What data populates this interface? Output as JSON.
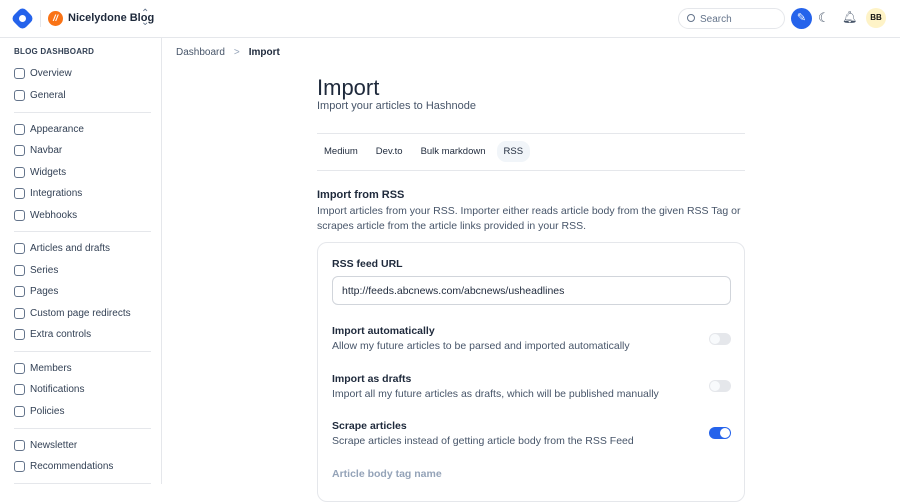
{
  "header": {
    "blog_initial": "//",
    "blog_name": "Nicelydone Blog",
    "search_placeholder": "Search",
    "avatar": "BB"
  },
  "sidebar": {
    "title": "BLOG DASHBOARD",
    "items": [
      {
        "label": "Overview",
        "icon": "overview-icon"
      },
      {
        "label": "General",
        "icon": "gear-icon"
      },
      {
        "label": "Appearance",
        "icon": "brush-icon"
      },
      {
        "label": "Navbar",
        "icon": "navbar-icon"
      },
      {
        "label": "Widgets",
        "icon": "puzzle-icon"
      },
      {
        "label": "Integrations",
        "icon": "plug-icon"
      },
      {
        "label": "Webhooks",
        "icon": "webhook-icon"
      },
      {
        "label": "Articles and drafts",
        "icon": "file-icon"
      },
      {
        "label": "Series",
        "icon": "series-icon"
      },
      {
        "label": "Pages",
        "icon": "page-icon"
      },
      {
        "label": "Custom page redirects",
        "icon": "redirect-icon"
      },
      {
        "label": "Extra controls",
        "icon": "controls-icon"
      },
      {
        "label": "Members",
        "icon": "members-icon"
      },
      {
        "label": "Notifications",
        "icon": "bell-icon"
      },
      {
        "label": "Policies",
        "icon": "policy-icon"
      },
      {
        "label": "Newsletter",
        "icon": "mail-icon"
      },
      {
        "label": "Recommendations",
        "icon": "recommend-icon"
      }
    ]
  },
  "breadcrumb": {
    "parent": "Dashboard",
    "sep": ">",
    "current": "Import"
  },
  "main": {
    "title": "Import",
    "subtitle": "Import your articles to Hashnode",
    "tabs": [
      {
        "label": "Medium"
      },
      {
        "label": "Dev.to"
      },
      {
        "label": "Bulk markdown"
      },
      {
        "label": "RSS"
      }
    ],
    "section_title": "Import from RSS",
    "section_desc": "Import articles from your RSS. Importer either reads article body from the given RSS Tag or scrapes article from the article links provided in your RSS.",
    "rss_label": "RSS feed URL",
    "rss_value": "http://feeds.abcnews.com/abcnews/usheadlines",
    "options": [
      {
        "title": "Import automatically",
        "desc": "Allow my future articles to be parsed and imported automatically",
        "enabled": false
      },
      {
        "title": "Import as drafts",
        "desc": "Import all my future articles as drafts, which will be published manually",
        "enabled": false
      },
      {
        "title": "Scrape articles",
        "desc": "Scrape articles instead of getting article body from the RSS Feed",
        "enabled": true
      }
    ],
    "body_tag_label": "Article body tag name"
  },
  "colors": {
    "accent": "#2563eb",
    "brand": "#f97316"
  }
}
